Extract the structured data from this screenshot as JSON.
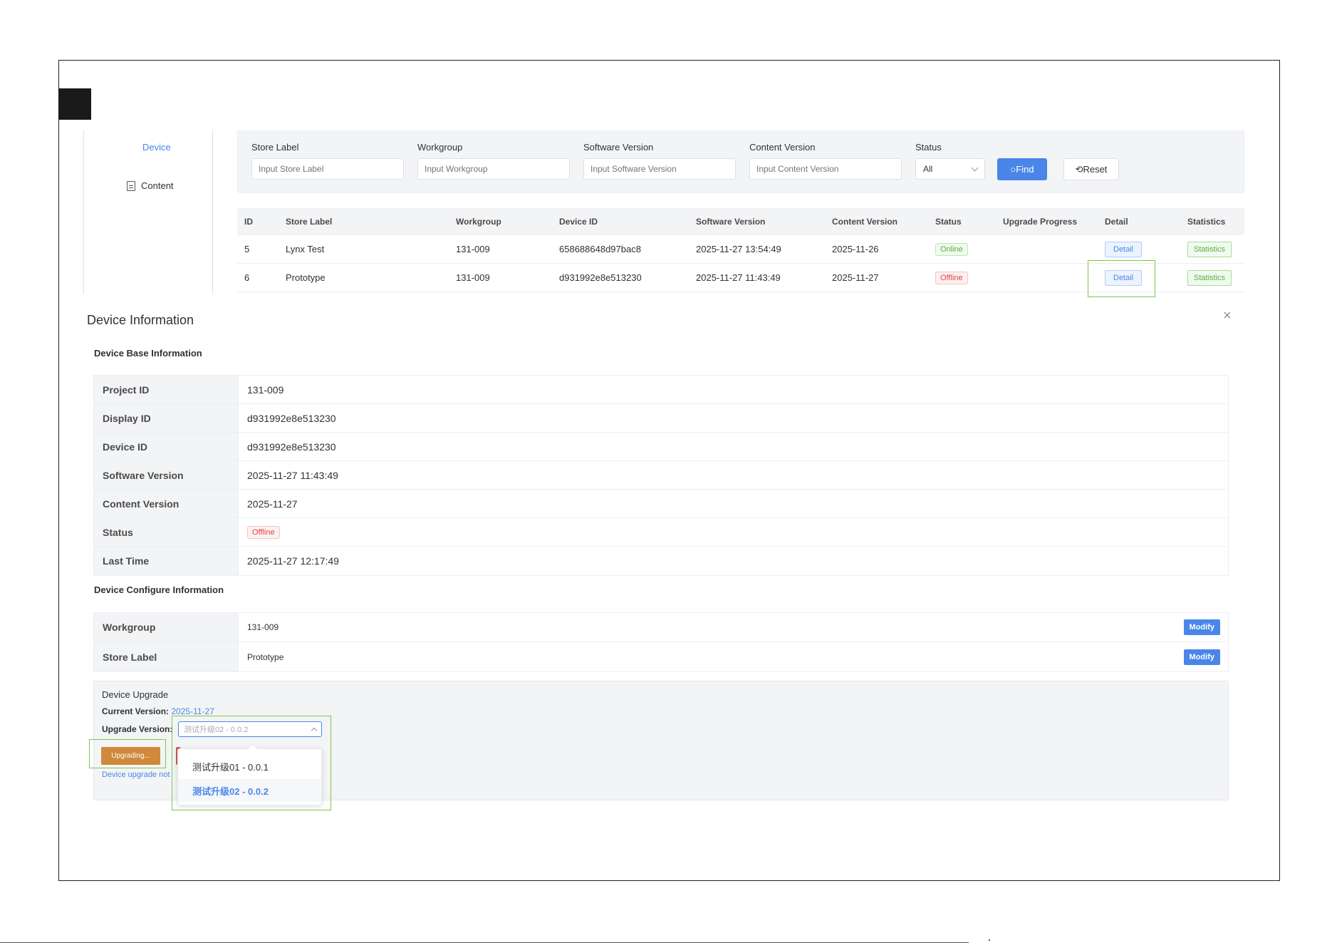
{
  "sidebar": {
    "items": [
      {
        "label": "Device",
        "icon": "grid-icon",
        "active": true
      },
      {
        "label": "Content",
        "icon": "document-icon",
        "active": false
      }
    ]
  },
  "filters": {
    "store_label": {
      "label": "Store Label",
      "placeholder": "Input Store Label"
    },
    "workgroup": {
      "label": "Workgroup",
      "placeholder": "Input Workgroup"
    },
    "software_version": {
      "label": "Software Version",
      "placeholder": "Input Software Version"
    },
    "content_version": {
      "label": "Content Version",
      "placeholder": "Input Content Version"
    },
    "status": {
      "label": "Status",
      "value": "All"
    },
    "find_label": "○Find",
    "reset_label": "⟲Reset"
  },
  "table": {
    "headers": [
      "ID",
      "Store Label",
      "Workgroup",
      "Device ID",
      "Software Version",
      "Content Version",
      "Status",
      "Upgrade Progress",
      "Detail",
      "Statistics"
    ],
    "rows": [
      {
        "id": "5",
        "store_label": "Lynx Test",
        "workgroup": "131-009",
        "device_id": "658688648d97bac8",
        "software_version": "2025-11-27 13:54:49",
        "content_version": "2025-11-26",
        "status": "Online",
        "detail": "Detail",
        "statistics": "Statistics"
      },
      {
        "id": "6",
        "store_label": "Prototype",
        "workgroup": "131-009",
        "device_id": "d931992e8e513230",
        "software_version": "2025-11-27 11:43:49",
        "content_version": "2025-11-27",
        "status": "Offline",
        "detail": "Detail",
        "statistics": "Statistics"
      }
    ]
  },
  "dialog": {
    "title": "Device Information",
    "close": "×",
    "base_title": "Device Base Information",
    "base": [
      {
        "key": "Project ID",
        "value": "131-009"
      },
      {
        "key": "Display ID",
        "value": "d931992e8e513230"
      },
      {
        "key": "Device ID",
        "value": "d931992e8e513230"
      },
      {
        "key": "Software Version",
        "value": "2025-11-27 11:43:49"
      },
      {
        "key": "Content Version",
        "value": "2025-11-27"
      },
      {
        "key": "Status",
        "value": "Offline"
      },
      {
        "key": "Last Time",
        "value": "2025-11-27 12:17:49"
      }
    ],
    "config_title": "Device Configure Information",
    "config": [
      {
        "key": "Workgroup",
        "value": "131-009",
        "action": "Modify"
      },
      {
        "key": "Store Label",
        "value": "Prototype",
        "action": "Modify"
      }
    ],
    "upgrade": {
      "title": "Device Upgrade",
      "current_label": "Current Version:",
      "current_value": "2025-11-27",
      "upgrade_label": "Upgrade Version:",
      "selected": "测试升级02 - 0.0.2",
      "button": "Upgrading...",
      "note": "Device upgrade not",
      "options": [
        "测试升级01 - 0.0.1",
        "测试升级02 - 0.0.2"
      ]
    }
  },
  "colors": {
    "primary": "#4a86e8",
    "success": "#5daf34",
    "danger": "#e04646",
    "warning": "#d0883a",
    "highlight": "#7ac943"
  }
}
